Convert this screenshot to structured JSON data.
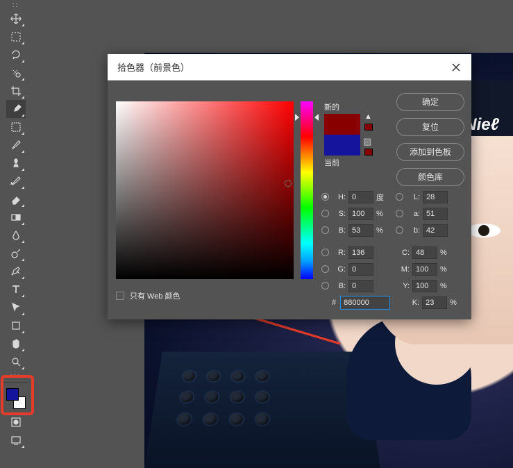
{
  "dialog": {
    "title": "拾色器（前景色）",
    "buttons": {
      "ok": "确定",
      "reset": "复位",
      "add": "添加到色板",
      "lib": "颜色库"
    },
    "compare": {
      "new": "新的",
      "current": "当前",
      "new_color": "#880000",
      "old_color": "#14159c"
    },
    "radios": {
      "H": {
        "label": "H:",
        "value": "0",
        "unit": "度"
      },
      "S": {
        "label": "S:",
        "value": "100",
        "unit": "%"
      },
      "Bv": {
        "label": "B:",
        "value": "53",
        "unit": "%"
      },
      "L": {
        "label": "L:",
        "value": "28"
      },
      "a": {
        "label": "a:",
        "value": "51"
      },
      "b": {
        "label": "b:",
        "value": "42"
      }
    },
    "rgb": {
      "R": {
        "label": "R:",
        "value": "136"
      },
      "G": {
        "label": "G:",
        "value": "0"
      },
      "Bc": {
        "label": "B:",
        "value": "0"
      }
    },
    "cmyk": {
      "C": {
        "label": "C:",
        "value": "48",
        "unit": "%"
      },
      "M": {
        "label": "M:",
        "value": "100",
        "unit": "%"
      },
      "Y": {
        "label": "Y:",
        "value": "100",
        "unit": "%"
      },
      "K": {
        "label": "K:",
        "value": "23",
        "unit": "%"
      }
    },
    "hex": {
      "label": "#",
      "value": "880000"
    },
    "webonly": "只有 Web 颜色"
  },
  "photo": {
    "hat_logo": "Nieℓ"
  }
}
